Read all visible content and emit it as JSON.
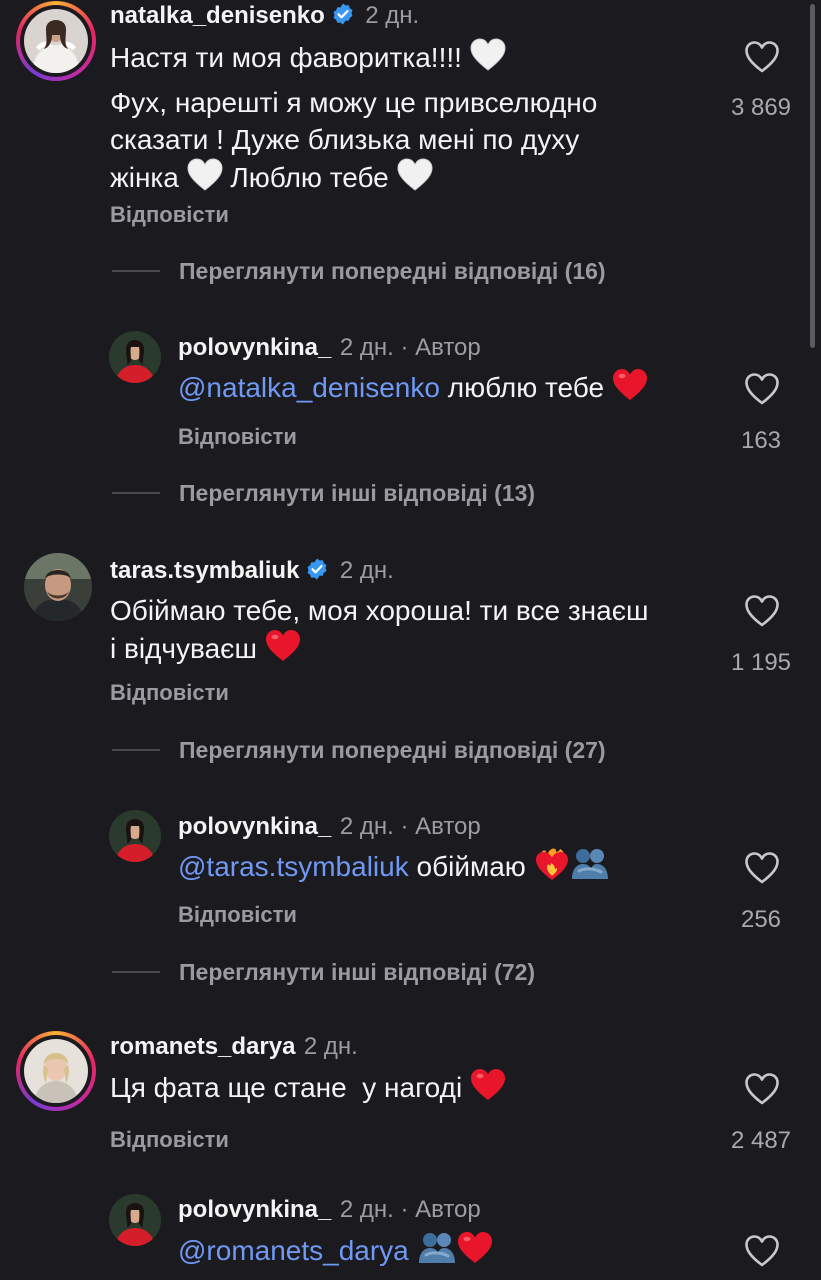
{
  "comments": [
    {
      "username": "natalka_denisenko",
      "verified": true,
      "time": "2 дн.",
      "lines": [
        "Настя ти моя фаворитка!!!!",
        "Фух, нарешті я можу це привселюдно",
        "сказати ! Дуже близька мені по духу",
        "жінка",
        "Люблю тебе"
      ],
      "reply_label": "Відповісти",
      "likes": "3 869",
      "view_replies": "Переглянути попередні відповіді (16)",
      "reply": {
        "username": "polovynkina_",
        "time": "2 дн. · Автор",
        "mention": "@natalka_denisenko",
        "text": "люблю тебе",
        "reply_label": "Відповісти",
        "likes": "163",
        "view_more": "Переглянути інші відповіді (13)"
      }
    },
    {
      "username": "taras.tsymbaliuk",
      "verified": true,
      "time": "2 дн.",
      "lines": [
        "Обіймаю тебе, моя хороша! ти все знаєш",
        "і відчуваєш"
      ],
      "reply_label": "Відповісти",
      "likes": "1 195",
      "view_replies": "Переглянути попередні відповіді (27)",
      "reply": {
        "username": "polovynkina_",
        "time": "2 дн. · Автор",
        "mention": "@taras.tsymbaliuk",
        "text": "обіймаю",
        "reply_label": "Відповісти",
        "likes": "256",
        "view_more": "Переглянути інші відповіді (72)"
      }
    },
    {
      "username": "romanets_darya",
      "verified": false,
      "time": "2 дн.",
      "lines": [
        "Ця фата ще стане  у нагоді"
      ],
      "reply_label": "Відповісти",
      "likes": "2 487",
      "reply": {
        "username": "polovynkina_",
        "time": "2 дн. · Автор",
        "mention": "@romanets_darya"
      }
    }
  ],
  "icons": [
    "heart-outline-icon",
    "verified-badge-icon",
    "white-heart-emoji",
    "red-heart-emoji",
    "heart-on-fire-emoji",
    "people-hugging-emoji"
  ],
  "colors": {
    "background": "#1b1b1f",
    "mention": "#6f99f4",
    "secondary": "#9a9aa0",
    "verified": "#3897f0"
  }
}
